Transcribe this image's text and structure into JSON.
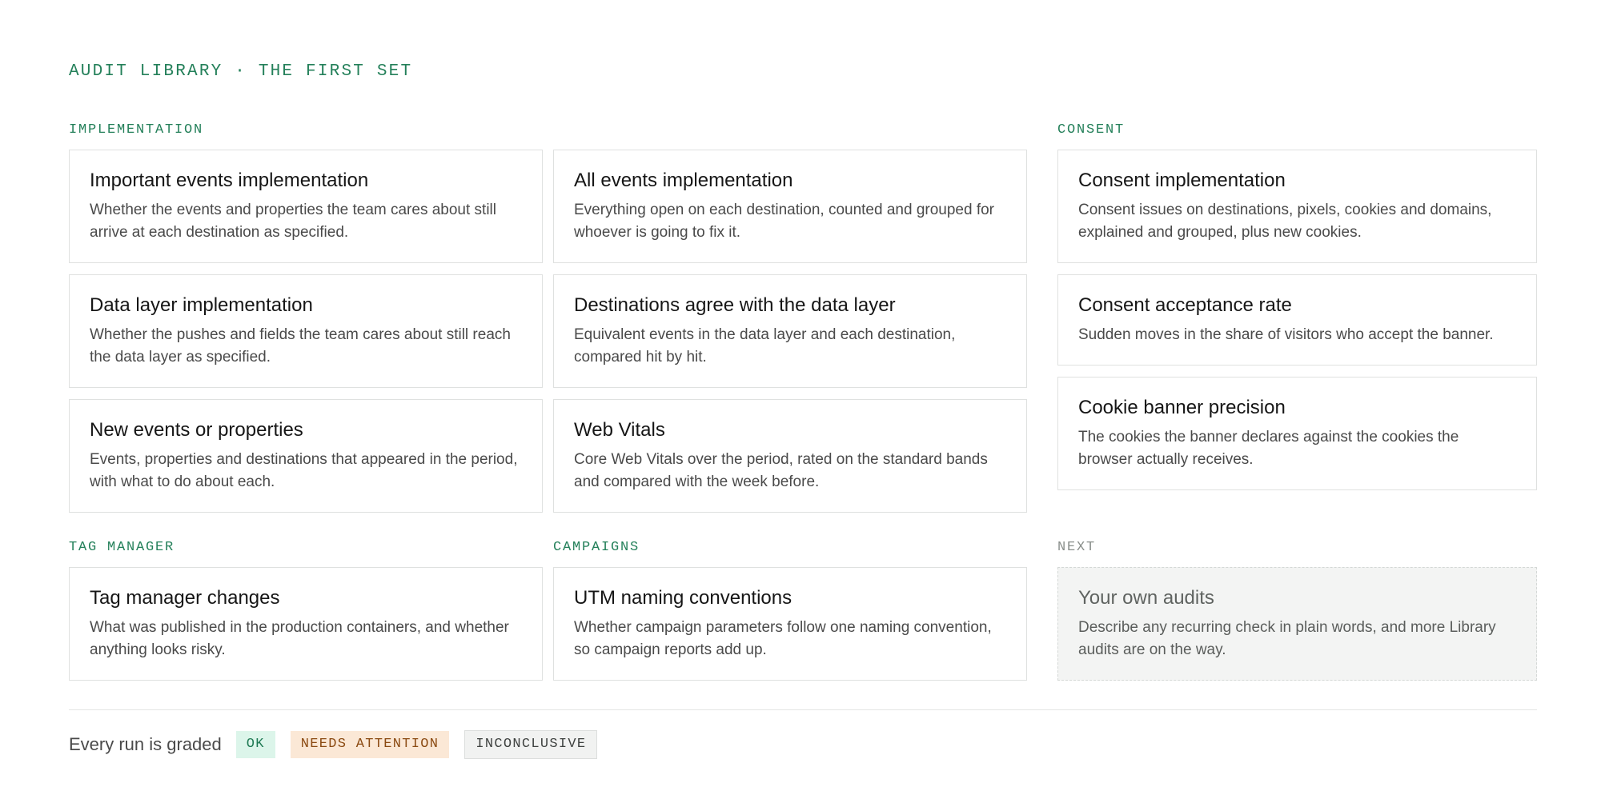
{
  "kicker": "AUDIT LIBRARY · THE FIRST SET",
  "sections": {
    "implementation": "IMPLEMENTATION",
    "consent": "CONSENT",
    "tag_manager": "TAG MANAGER",
    "campaigns": "CAMPAIGNS",
    "next": "NEXT"
  },
  "cards": {
    "important_events": {
      "title": "Important events implementation",
      "desc": "Whether the events and properties the team cares about still arrive at each destination as specified."
    },
    "all_events": {
      "title": "All events implementation",
      "desc": "Everything open on each destination, counted and grouped for whoever is going to fix it."
    },
    "consent_impl": {
      "title": "Consent implementation",
      "desc": "Consent issues on destinations, pixels, cookies and domains, explained and grouped, plus new cookies."
    },
    "data_layer": {
      "title": "Data layer implementation",
      "desc": "Whether the pushes and fields the team cares about still reach the data layer as specified."
    },
    "destinations_agree": {
      "title": "Destinations agree with the data layer",
      "desc": "Equivalent events in the data layer and each destination, compared hit by hit."
    },
    "consent_rate": {
      "title": "Consent acceptance rate",
      "desc": "Sudden moves in the share of visitors who accept the banner."
    },
    "new_events": {
      "title": "New events or properties",
      "desc": "Events, properties and destinations that appeared in the period, with what to do about each."
    },
    "web_vitals": {
      "title": "Web Vitals",
      "desc": "Core Web Vitals over the period, rated on the standard bands and compared with the week before."
    },
    "cookie_banner": {
      "title": "Cookie banner precision",
      "desc": "The cookies the banner declares against the cookies the browser actually receives."
    },
    "tag_manager_changes": {
      "title": "Tag manager changes",
      "desc": "What was published in the production containers, and whether anything looks risky."
    },
    "utm": {
      "title": "UTM naming conventions",
      "desc": "Whether campaign parameters follow one naming convention, so campaign reports add up."
    },
    "own_audits": {
      "title": "Your own audits",
      "desc": "Describe any recurring check in plain words, and more Library audits are on the way."
    }
  },
  "legend": {
    "text": "Every run is graded",
    "ok": "OK",
    "needs_attention": "NEEDS ATTENTION",
    "inconclusive": "INCONCLUSIVE"
  }
}
